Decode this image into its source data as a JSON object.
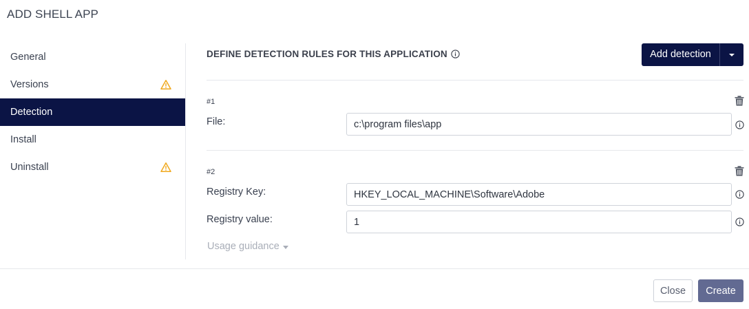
{
  "dialog": {
    "title": "ADD SHELL APP"
  },
  "sidebar": {
    "items": [
      {
        "label": "General",
        "warning": false,
        "active": false
      },
      {
        "label": "Versions",
        "warning": true,
        "active": false
      },
      {
        "label": "Detection",
        "warning": false,
        "active": true
      },
      {
        "label": "Install",
        "warning": false,
        "active": false
      },
      {
        "label": "Uninstall",
        "warning": true,
        "active": false
      }
    ]
  },
  "main": {
    "heading": "DEFINE DETECTION RULES FOR THIS APPLICATION",
    "add_detection": {
      "label": "Add detection"
    },
    "rules": [
      {
        "number": "#1",
        "fields": [
          {
            "label": "File:",
            "value": "c:\\program files\\app"
          }
        ]
      },
      {
        "number": "#2",
        "fields": [
          {
            "label": "Registry Key:",
            "value": "HKEY_LOCAL_MACHINE\\Software\\Adobe"
          },
          {
            "label": "Registry value:",
            "value": "1"
          }
        ]
      }
    ],
    "usage_guidance": "Usage guidance"
  },
  "footer": {
    "close_label": "Close",
    "create_label": "Create"
  },
  "colors": {
    "accent": "#0b1445",
    "warning": "#f0a81c",
    "create_button": "#626a92"
  },
  "icons": [
    "warning-icon",
    "info-icon",
    "trash-icon",
    "caret-down-icon"
  ]
}
